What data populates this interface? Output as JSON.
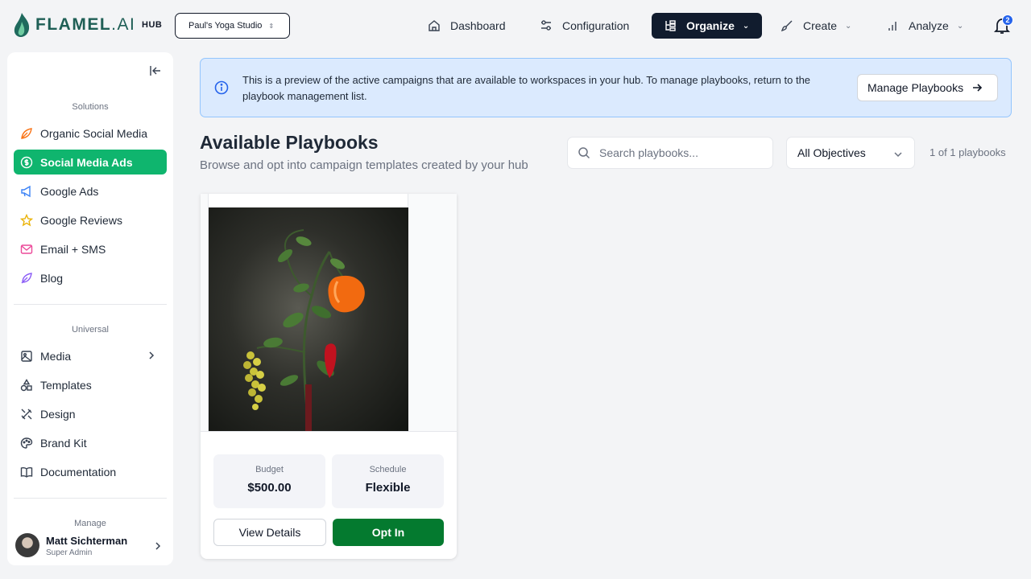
{
  "brand": {
    "logo_text_1": "FLAMEL",
    "logo_text_2": ".AI",
    "hub_label": "HUB",
    "accent": "#0fb56e",
    "primary_dark": "#111c2e"
  },
  "workspace": {
    "selected": "Paul's Yoga Studio"
  },
  "nav": {
    "dashboard": "Dashboard",
    "configuration": "Configuration",
    "organize": "Organize",
    "create": "Create",
    "analyze": "Analyze"
  },
  "notifications": {
    "count": "2"
  },
  "sidebar": {
    "solutions_label": "Solutions",
    "solutions": [
      {
        "label": "Organic Social Media",
        "icon": "leaf-icon"
      },
      {
        "label": "Social Media Ads",
        "icon": "dollar-icon",
        "active": true
      },
      {
        "label": "Google Ads",
        "icon": "megaphone-icon"
      },
      {
        "label": "Google Reviews",
        "icon": "star-icon"
      },
      {
        "label": "Email + SMS",
        "icon": "mail-icon"
      },
      {
        "label": "Blog",
        "icon": "feather-icon"
      }
    ],
    "universal_label": "Universal",
    "universal": [
      {
        "label": "Media",
        "icon": "image-icon"
      },
      {
        "label": "Templates",
        "icon": "shapes-icon"
      },
      {
        "label": "Design",
        "icon": "design-icon"
      },
      {
        "label": "Brand Kit",
        "icon": "palette-icon"
      },
      {
        "label": "Documentation",
        "icon": "book-icon"
      }
    ],
    "manage_label": "Manage",
    "user": {
      "name": "Matt Sichterman",
      "role": "Super Admin"
    }
  },
  "banner": {
    "text": "This is a preview of the active campaigns that are available to workspaces in your hub. To manage playbooks, return to the playbook management list.",
    "button": "Manage Playbooks"
  },
  "main": {
    "title": "Available Playbooks",
    "subtitle": "Browse and opt into campaign templates created by your hub",
    "search_placeholder": "Search playbooks...",
    "objective_filter": "All Objectives",
    "count_text": "1 of 1 playbooks"
  },
  "playbook_card": {
    "budget_label": "Budget",
    "budget_value": "$500.00",
    "schedule_label": "Schedule",
    "schedule_value": "Flexible",
    "view_details": "View Details",
    "opt_in": "Opt In"
  }
}
